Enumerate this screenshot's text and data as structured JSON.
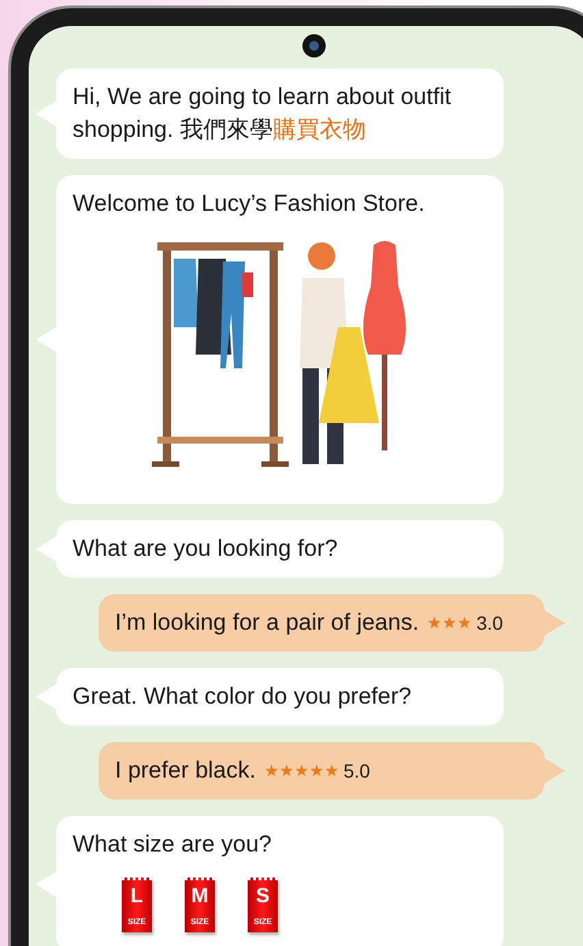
{
  "messages": [
    {
      "outgoing": false,
      "kind": "text",
      "text": "Hi, We are going to learn about outfit shopping. 我們來學",
      "highlight": "購買衣物"
    },
    {
      "outgoing": false,
      "kind": "image",
      "text": "Welcome to Lucy’s Fashion Store."
    },
    {
      "outgoing": false,
      "kind": "text",
      "text": "What are you looking for?"
    },
    {
      "outgoing": true,
      "kind": "rated",
      "text": "I’m looking for a pair of jeans.",
      "stars": 3,
      "score": "3.0"
    },
    {
      "outgoing": false,
      "kind": "text",
      "text": "Great. What color do you prefer?"
    },
    {
      "outgoing": true,
      "kind": "rated",
      "text": "I prefer black.",
      "stars": 5,
      "score": "5.0"
    },
    {
      "outgoing": false,
      "kind": "sizes",
      "text": "What size are you?",
      "sizes": [
        {
          "letter": "L",
          "caption": "SIZE"
        },
        {
          "letter": "M",
          "caption": "SIZE"
        },
        {
          "letter": "S",
          "caption": "SIZE"
        }
      ]
    }
  ]
}
